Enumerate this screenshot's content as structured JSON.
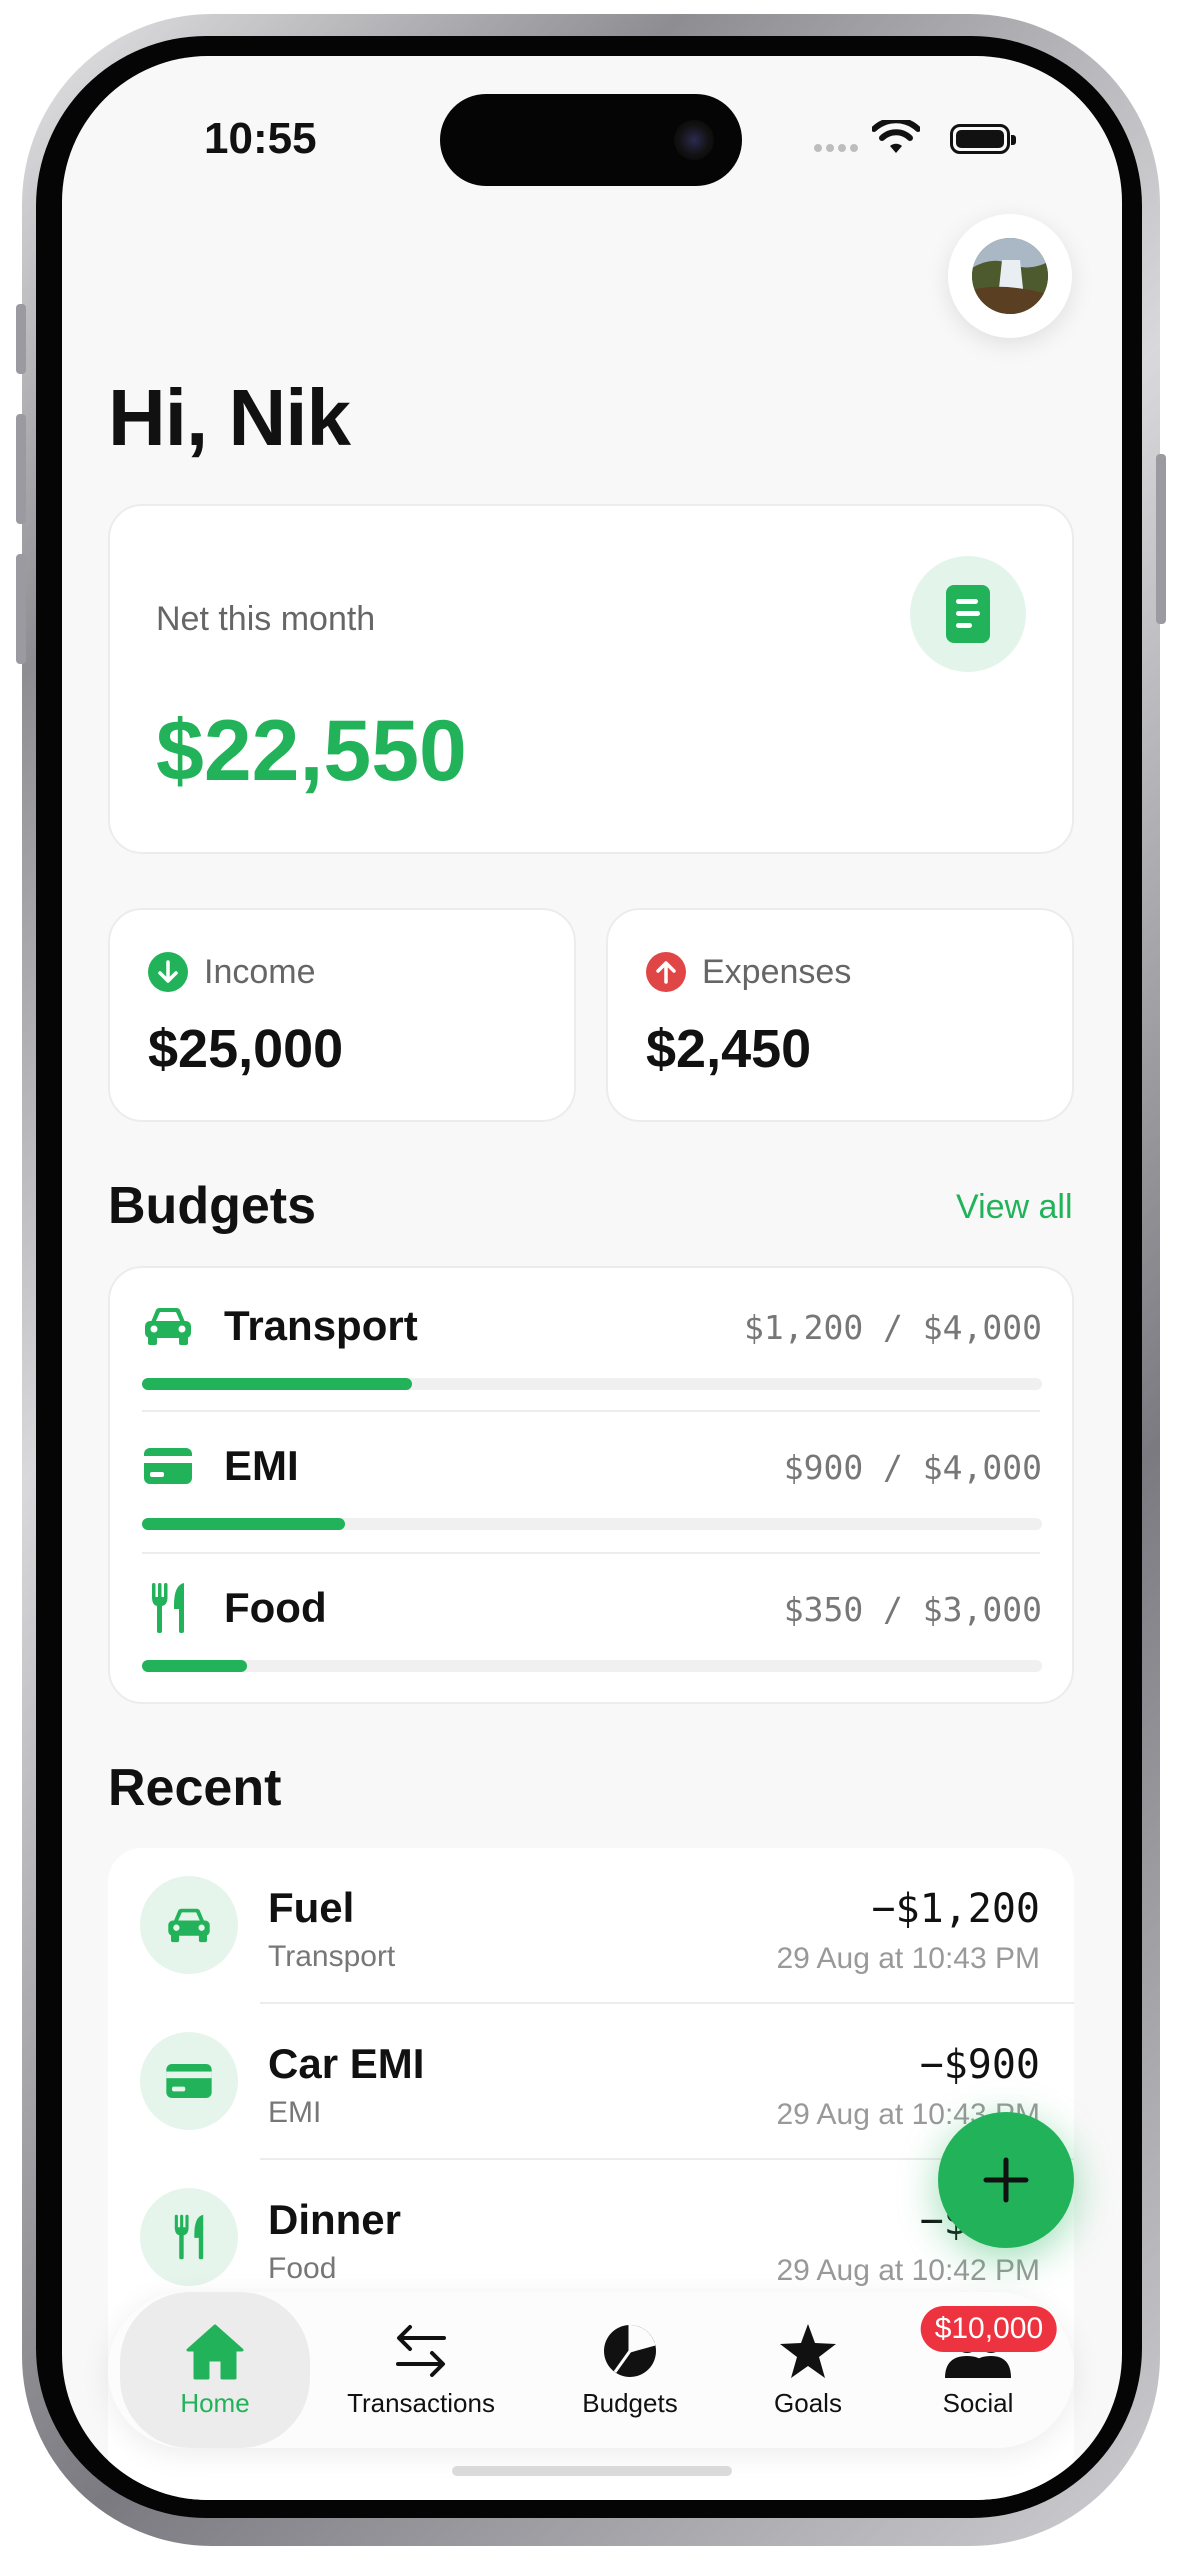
{
  "status_bar": {
    "time": "10:55"
  },
  "greeting": "Hi, Nik",
  "summary": {
    "net_label": "Net this month",
    "net_value": "$22,550",
    "income_label": "Income",
    "income_value": "$25,000",
    "expenses_label": "Expenses",
    "expenses_value": "$2,450"
  },
  "budgets": {
    "title": "Budgets",
    "view_all": "View all",
    "items": [
      {
        "name": "Transport",
        "amount": "$1,200 / $4,000",
        "progress": 0.3,
        "icon": "car-icon"
      },
      {
        "name": "EMI",
        "amount": "$900 / $4,000",
        "progress": 0.225,
        "icon": "credit-card-icon"
      },
      {
        "name": "Food",
        "amount": "$350 / $3,000",
        "progress": 0.117,
        "icon": "fork-knife-icon"
      }
    ]
  },
  "recent": {
    "title": "Recent",
    "items": [
      {
        "name": "Fuel",
        "category": "Transport",
        "amount": "−$1,200",
        "date": "29 Aug at 10:43 PM",
        "icon": "car-icon"
      },
      {
        "name": "Car EMI",
        "category": "EMI",
        "amount": "−$900",
        "date": "29 Aug at 10:43 PM",
        "icon": "credit-card-icon"
      },
      {
        "name": "Dinner",
        "category": "Food",
        "amount": "−$350",
        "date": "29 Aug at 10:42 PM",
        "icon": "fork-knife-icon"
      }
    ]
  },
  "fab": {
    "icon": "plus-icon"
  },
  "tabs": [
    {
      "label": "Home",
      "icon": "house-icon",
      "active": true
    },
    {
      "label": "Transactions",
      "icon": "arrows-left-right-icon"
    },
    {
      "label": "Budgets",
      "icon": "pie-chart-icon"
    },
    {
      "label": "Goals",
      "icon": "star-icon"
    },
    {
      "label": "Social",
      "icon": "people-icon",
      "badge": "$10,000"
    }
  ],
  "colors": {
    "accent": "#22b35a",
    "expense_red": "#e04646",
    "badge_red": "#ee3340"
  }
}
